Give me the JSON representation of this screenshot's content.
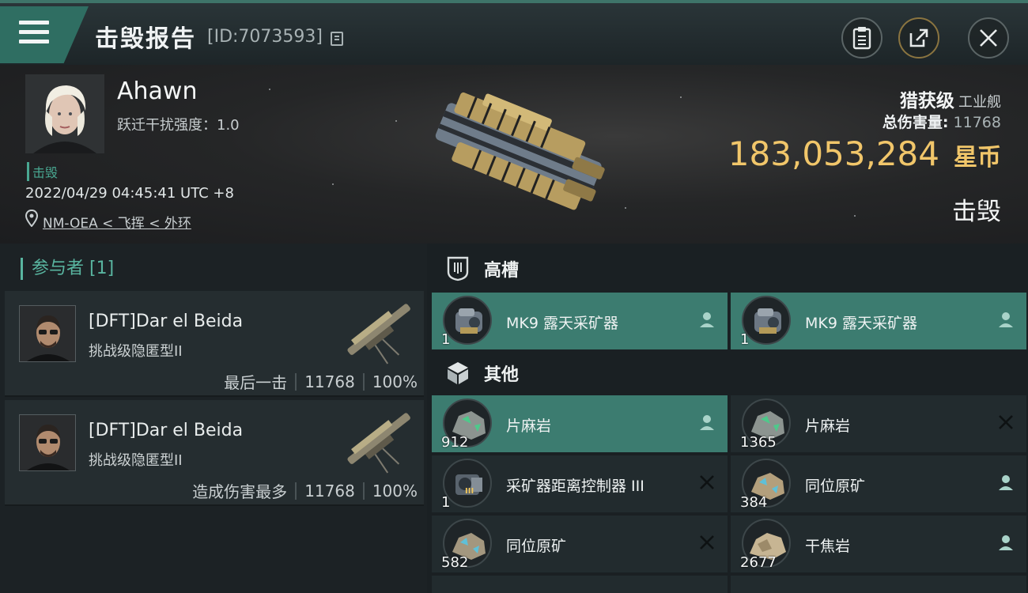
{
  "header": {
    "title": "击毁报告",
    "report_id": "[ID:7073593]"
  },
  "victim": {
    "pilot_name": "Ahawn",
    "warp_scramble": "跃迁干扰强度：1.0",
    "status_tag": "击毁",
    "datetime": "2022/04/29 04:45:41 UTC +8",
    "location": "NM-OEA < 飞挥 < 外环",
    "ship_class": "猎获级",
    "ship_type": "工业舰",
    "damage_label": "总伤害量:",
    "damage_value": "11768",
    "isk_value": "183,053,284",
    "isk_unit": "星币",
    "result": "击毁"
  },
  "participants": {
    "title": "参与者 [1]",
    "rows": [
      {
        "name": "[DFT]Dar el Beida",
        "ship": "挑战级隐匿型II",
        "role": "最后一击",
        "damage": "11768",
        "percent": "100%"
      },
      {
        "name": "[DFT]Dar el Beida",
        "ship": "挑战级隐匿型II",
        "role": "造成伤害最多",
        "damage": "11768",
        "percent": "100%"
      }
    ]
  },
  "fittings": {
    "high_slots": {
      "label": "高槽",
      "items": [
        {
          "name": "MK9 露天采矿器",
          "qty": "1",
          "state": "dropped",
          "icon": "miner-icon"
        },
        {
          "name": "MK9 露天采矿器",
          "qty": "1",
          "state": "dropped",
          "icon": "miner-icon"
        }
      ]
    },
    "other": {
      "label": "其他",
      "items": [
        {
          "name": "片麻岩",
          "qty": "912",
          "state": "dropped",
          "icon": "ore-icon"
        },
        {
          "name": "片麻岩",
          "qty": "1365",
          "state": "destroyed",
          "icon": "ore-icon"
        },
        {
          "name": "采矿器距离控制器 III",
          "qty": "1",
          "state": "destroyed",
          "icon": "module-icon"
        },
        {
          "name": "同位原矿",
          "qty": "384",
          "state": "dropped",
          "icon": "ore-icon"
        },
        {
          "name": "同位原矿",
          "qty": "582",
          "state": "destroyed",
          "icon": "ore-icon"
        },
        {
          "name": "干焦岩",
          "qty": "2677",
          "state": "dropped",
          "icon": "ore-icon"
        }
      ]
    }
  },
  "colors": {
    "accent": "#3c7c70",
    "isk": "#f1c66a",
    "tag": "#49a892"
  }
}
